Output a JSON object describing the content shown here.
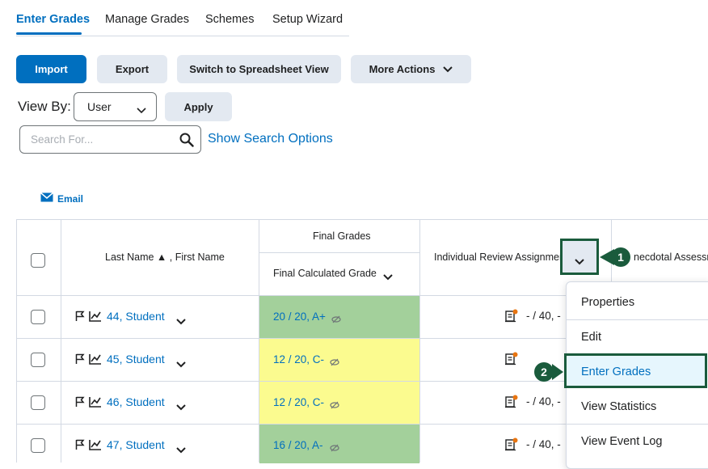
{
  "tabs": [
    {
      "label": "Enter Grades",
      "active": true
    },
    {
      "label": "Manage Grades"
    },
    {
      "label": "Schemes"
    },
    {
      "label": "Setup Wizard"
    }
  ],
  "toolbar": {
    "import_label": "Import",
    "export_label": "Export",
    "spreadsheet_label": "Switch to Spreadsheet View",
    "more_actions_label": "More Actions"
  },
  "view_by": {
    "label": "View By:",
    "selected": "User",
    "apply_label": "Apply"
  },
  "search": {
    "placeholder": "Search For...",
    "options_link": "Show Search Options"
  },
  "email_label": "Email",
  "grid": {
    "name_header": "Last Name ▲ , First Name",
    "final_grades_header": "Final Grades",
    "final_calculated_header": "Final Calculated Grade",
    "individual_header": "Individual Review Assignment",
    "anecdotal_header": "necdotal Assessm",
    "rows": [
      {
        "name": "44, Student",
        "grade": "20 / 20, A+",
        "grade_color": "#a3d09b",
        "score": "- / 40, -"
      },
      {
        "name": "45, Student",
        "grade": "12 / 20, C-",
        "grade_color": "#fbfb8f",
        "score": ""
      },
      {
        "name": "46, Student",
        "grade": "12 / 20, C-",
        "grade_color": "#fbfb8f",
        "score": "- / 40, -"
      },
      {
        "name": "47, Student",
        "grade": "16 / 20, A-",
        "grade_color": "#a3d09b",
        "score": "- / 40, -"
      }
    ]
  },
  "menu": {
    "items": [
      "Properties",
      "Edit",
      "Enter Grades",
      "View Statistics",
      "View Event Log"
    ]
  },
  "callouts": {
    "one": "1",
    "two": "2"
  },
  "colors": {
    "accent": "#006fbf",
    "callout": "#1a5b3c",
    "highlight": "#e6f6fd"
  }
}
